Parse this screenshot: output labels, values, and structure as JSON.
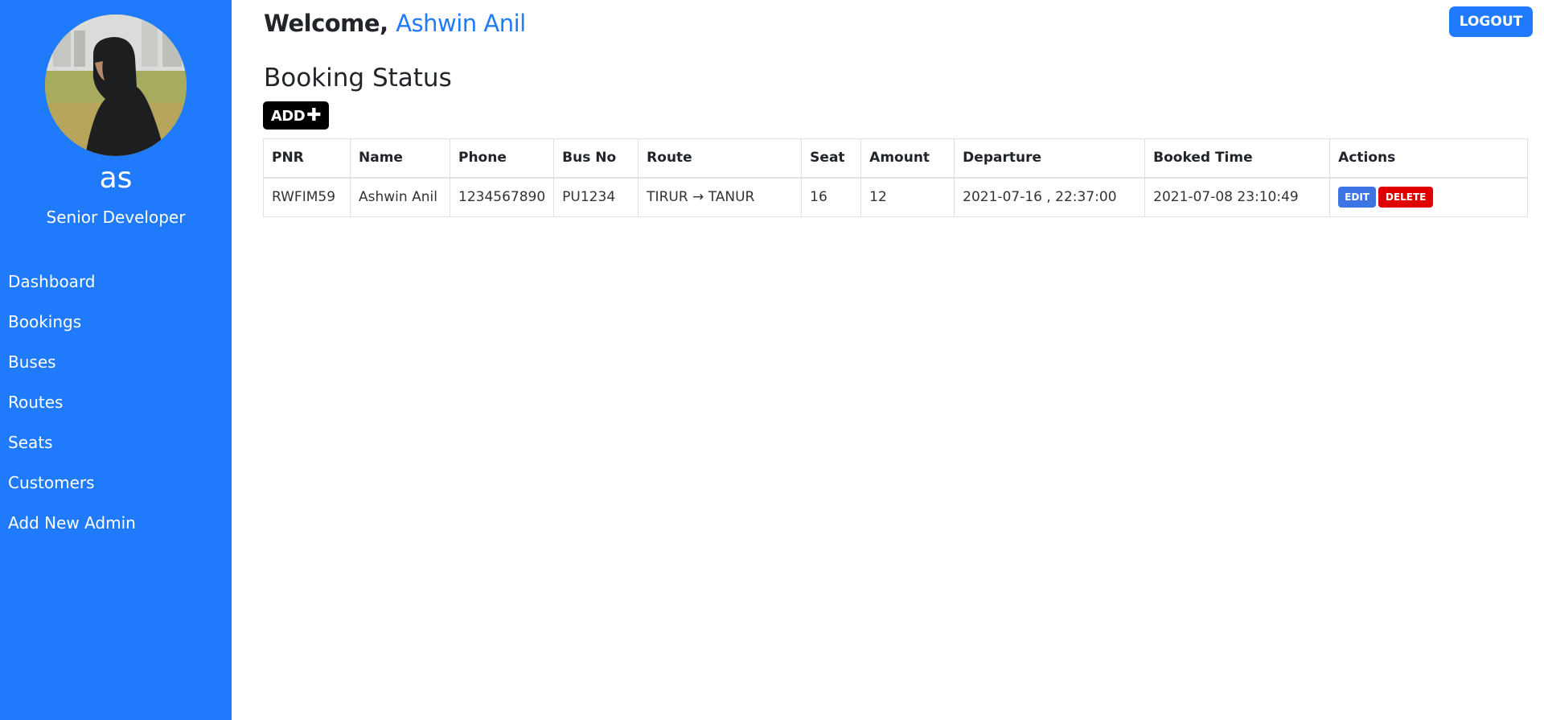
{
  "sidebar": {
    "profile": {
      "name": "as",
      "role": "Senior Developer"
    },
    "nav": [
      {
        "label": "Dashboard",
        "icon": ""
      },
      {
        "label": "Bookings",
        "icon": ""
      },
      {
        "label": "Buses",
        "icon": ""
      },
      {
        "label": "Routes",
        "icon": ""
      },
      {
        "label": "Seats",
        "icon": ""
      },
      {
        "label": "Customers",
        "icon": ""
      },
      {
        "label": "Add New Admin",
        "icon": ""
      }
    ]
  },
  "header": {
    "welcome_prefix": "Welcome,",
    "user_name": "Ashwin Anil",
    "logout_label": "LOGOUT"
  },
  "main": {
    "title": "Booking Status",
    "add_label": "ADD",
    "add_icon": "plus-icon",
    "table": {
      "columns": [
        "PNR",
        "Name",
        "Phone",
        "Bus No",
        "Route",
        "Seat",
        "Amount",
        "Departure",
        "Booked Time",
        "Actions"
      ],
      "rows": [
        {
          "pnr": "RWFIM59",
          "name": "Ashwin Anil",
          "phone": "1234567890",
          "bus_no": "PU1234",
          "route": "TIRUR → TANUR",
          "seat": "16",
          "amount": "12",
          "departure": "2021-07-16 , 22:37:00",
          "booked_time": "2021-07-08 23:10:49",
          "edit_label": "EDIT",
          "delete_label": "DELETE"
        }
      ]
    }
  },
  "colors": {
    "sidebar_bg": "#1f7bfc",
    "accent": "#1f7bfc",
    "edit": "#3d74e4",
    "delete": "#e00000"
  }
}
